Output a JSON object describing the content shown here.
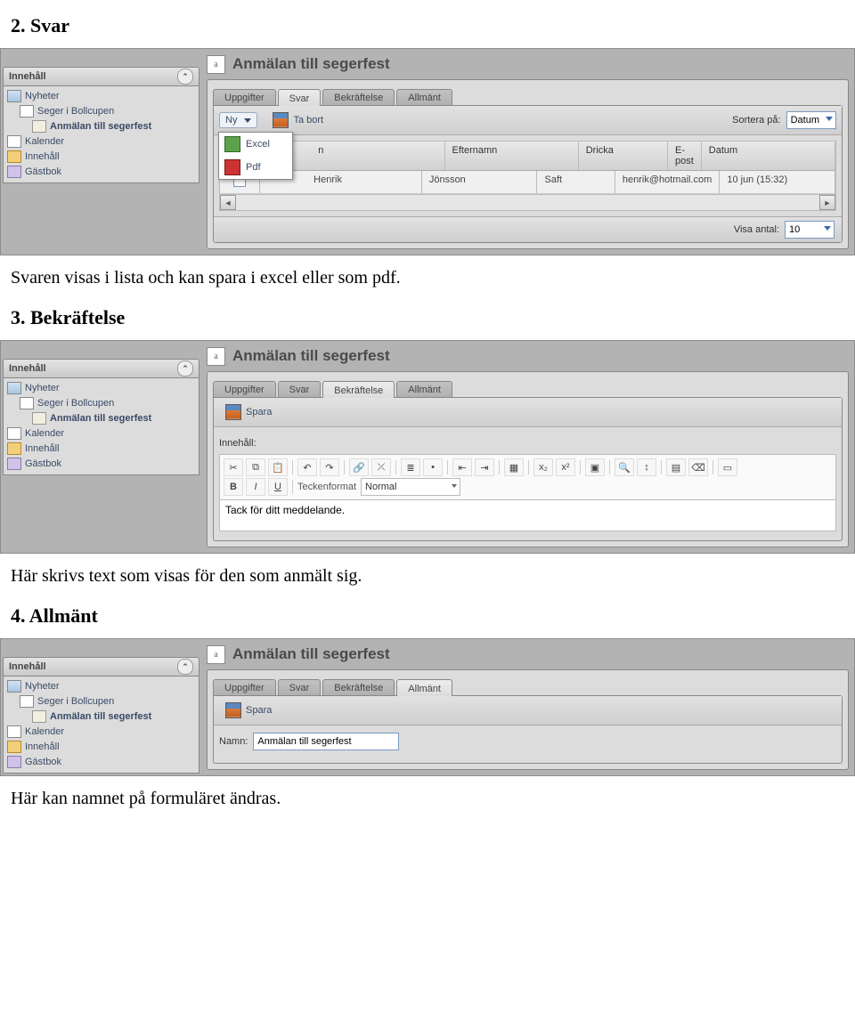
{
  "doc": {
    "h1": "2. Svar",
    "p1": "Svaren visas i lista och kan spara i excel eller som pdf.",
    "h2": "3. Bekräftelse",
    "p2": "Här skrivs text som visas för den som anmält sig.",
    "h3": "4. Allmänt",
    "p3": "Här kan namnet på formuläret ändras."
  },
  "common": {
    "sidebar_head": "Innehåll",
    "tree": {
      "nyheter": "Nyheter",
      "seger": "Seger i Bollcupen",
      "anmalan": "Anmälan till segerfest",
      "kalender": "Kalender",
      "innehall": "Innehåll",
      "gastbok": "Gästbok"
    },
    "page_icon": "a",
    "page_title": "Anmälan till segerfest",
    "tabs": {
      "uppgifter": "Uppgifter",
      "svar": "Svar",
      "bekraftelse": "Bekräftelse",
      "allmant": "Allmänt"
    }
  },
  "svar": {
    "ny": "Ny",
    "tabort": "Ta bort",
    "sortera_label": "Sortera på:",
    "sortera_value": "Datum",
    "dropdown": {
      "excel": "Excel",
      "pdf": "Pdf"
    },
    "cols": {
      "check": "",
      "fname_head_partial": "n",
      "lname": "Efternamn",
      "dricka": "Dricka",
      "epost": "E-post",
      "datum": "Datum"
    },
    "row": {
      "fname_partial": "Henrik",
      "lname": "Jönsson",
      "dricka": "Saft",
      "epost": "henrik@hotmail.com",
      "datum": "10 jun (15:32)"
    },
    "visa_antal_label": "Visa antal:",
    "visa_antal_value": "10"
  },
  "bekraft": {
    "spara": "Spara",
    "innehall_label": "Innehåll:",
    "format_label": "Teckenformat",
    "format_value": "Normal",
    "content": "Tack för ditt meddelande."
  },
  "allmant": {
    "spara": "Spara",
    "namn_label": "Namn:",
    "namn_value": "Anmälan till segerfest"
  }
}
